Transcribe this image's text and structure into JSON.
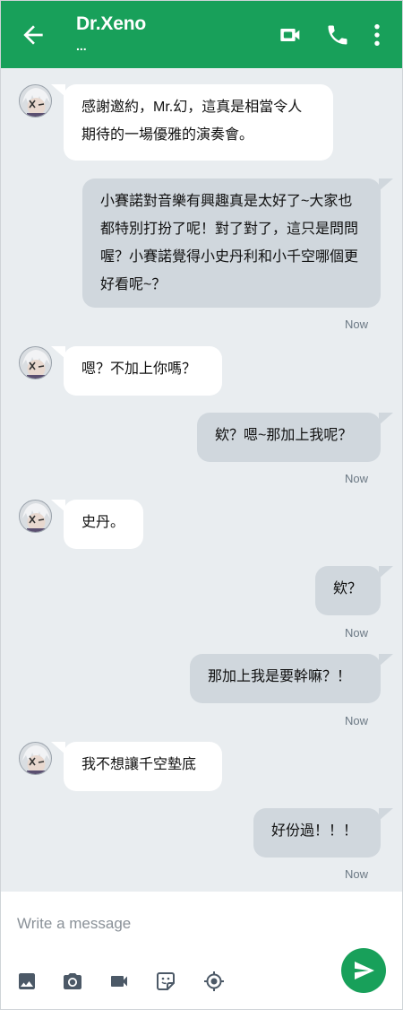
{
  "header": {
    "title": "Dr.Xeno",
    "subtitle": "...",
    "back_icon": "arrow-left-icon",
    "video_icon": "video-camera-icon",
    "phone_icon": "phone-icon",
    "more_icon": "more-vertical-icon",
    "color": "#18a05a"
  },
  "messages": [
    {
      "direction": "incoming",
      "text": "感謝邀約，Mr.幻，這真是相當令人期待的一場優雅的演奏會。"
    },
    {
      "direction": "outgoing",
      "text": "小賽諾對音樂有興趣真是太好了~大家也都特別打扮了呢！對了對了，這只是問問喔？小賽諾覺得小史丹利和小千空哪個更好看呢~？",
      "time": "Now"
    },
    {
      "direction": "incoming",
      "text": "嗯？不加上你嗎？"
    },
    {
      "direction": "outgoing",
      "text": "欸？嗯~那加上我呢？",
      "time": "Now"
    },
    {
      "direction": "incoming",
      "text": "史丹。"
    },
    {
      "direction": "outgoing",
      "text": "欸？",
      "time": "Now"
    },
    {
      "direction": "outgoing",
      "text": "那加上我是要幹嘛？！",
      "time": "Now"
    },
    {
      "direction": "incoming",
      "text": "我不想讓千空墊底"
    },
    {
      "direction": "outgoing",
      "text": "好份過！！！",
      "time": "Now"
    }
  ],
  "composer": {
    "placeholder": "Write a message",
    "tools": [
      "image-icon",
      "camera-icon",
      "video-icon",
      "sticker-icon",
      "location-icon"
    ],
    "send_icon": "send-icon",
    "send_color": "#18a05a"
  }
}
